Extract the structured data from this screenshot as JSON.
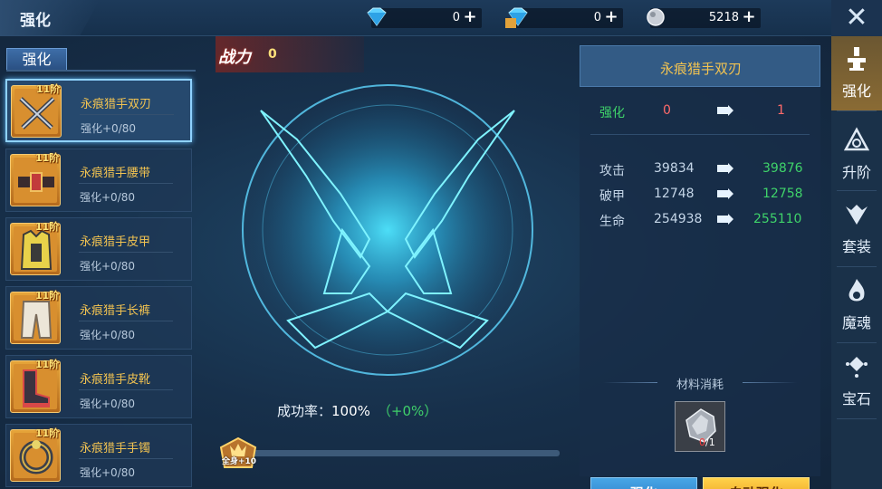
{
  "header": {
    "title": "强化"
  },
  "currencies": [
    {
      "icon": "blue-diamond-icon",
      "value": "0",
      "plus": "+"
    },
    {
      "icon": "bound-diamond-icon",
      "value": "0",
      "plus": "+",
      "tag": "绑"
    },
    {
      "icon": "silver-coin-icon",
      "value": "5218",
      "plus": "+"
    }
  ],
  "close_label": "✕",
  "rail": [
    {
      "label": "强化",
      "icon": "anvil-icon",
      "active": true
    },
    {
      "label": "升阶",
      "icon": "triangle-upgrade-icon",
      "active": false
    },
    {
      "label": "套装",
      "icon": "suit-wings-icon",
      "active": false
    },
    {
      "label": "魔魂",
      "icon": "flame-soul-icon",
      "active": false
    },
    {
      "label": "宝石",
      "icon": "gem-icon",
      "active": false
    }
  ],
  "left": {
    "tab_label": "强化",
    "items": [
      {
        "tier": "11阶",
        "name": "永痕猎手双刃",
        "level": "强化+0/80",
        "icon": "dual-blades-icon",
        "selected": true
      },
      {
        "tier": "11阶",
        "name": "永痕猎手腰带",
        "level": "强化+0/80",
        "icon": "belt-icon",
        "selected": false
      },
      {
        "tier": "11阶",
        "name": "永痕猎手皮甲",
        "level": "强化+0/80",
        "icon": "armor-icon",
        "selected": false
      },
      {
        "tier": "11阶",
        "name": "永痕猎手长裤",
        "level": "强化+0/80",
        "icon": "pants-icon",
        "selected": false
      },
      {
        "tier": "11阶",
        "name": "永痕猎手皮靴",
        "level": "强化+0/80",
        "icon": "boots-icon",
        "selected": false
      },
      {
        "tier": "11阶",
        "name": "永痕猎手手镯",
        "level": "强化+0/80",
        "icon": "bracelet-icon",
        "selected": false
      }
    ]
  },
  "center": {
    "power_label": "战力",
    "power_value": "0",
    "success_label": "成功率：",
    "success_value": "100%",
    "success_delta": "（+0%）",
    "badge_text": "全身+10",
    "progress": 0.0
  },
  "right": {
    "title": "永痕猎手双刃",
    "enhance": {
      "label": "强化",
      "from": "0",
      "to": "1"
    },
    "stats": [
      {
        "name": "攻击",
        "from": "39834",
        "to": "39876"
      },
      {
        "name": "破甲",
        "from": "12748",
        "to": "12758"
      },
      {
        "name": "生命",
        "from": "254938",
        "to": "255110"
      }
    ],
    "material_title": "材料消耗",
    "material_have": "0",
    "material_need": "/1",
    "material_icon": "enhance-stone-icon",
    "btn_enhance": "强化",
    "btn_auto": "自动强化"
  }
}
